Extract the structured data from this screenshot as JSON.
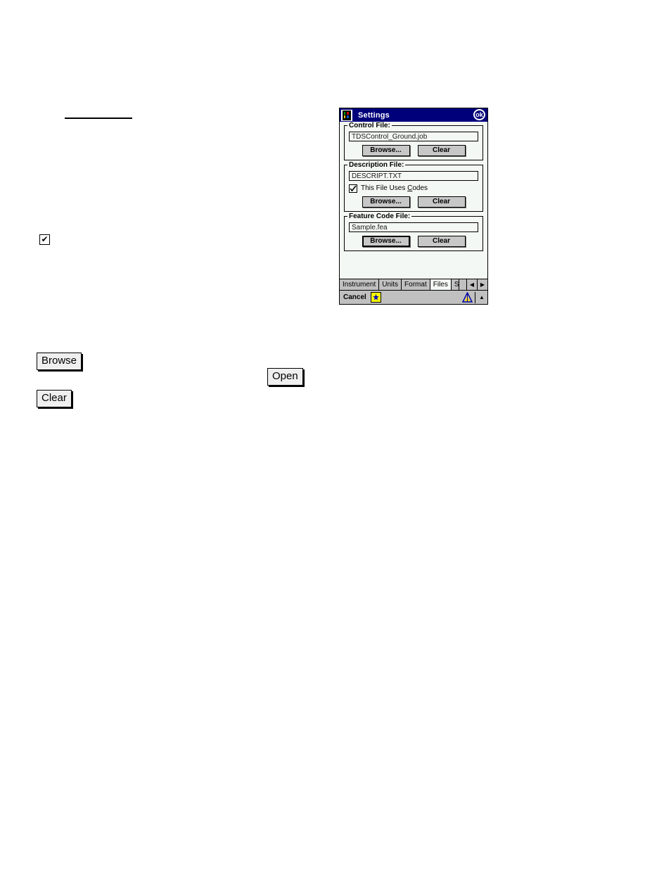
{
  "page": {
    "background": "#ffffff",
    "rule_mark": "horizontal-rule",
    "inline_graphics": {
      "browse_label": "Browse",
      "clear_label": "Clear",
      "open_label": "Open",
      "checkbox_glyph": "✔"
    }
  },
  "dialog": {
    "titlebar": {
      "app_icon": "settings-app-icon",
      "title": "Settings",
      "ok_label": "ok",
      "background": "#00007b",
      "text_color": "#ffffff"
    },
    "groups": [
      {
        "id": "control-file",
        "legend": "Control File:",
        "value": "TDSControl_Ground.job",
        "browse_label": "Browse...",
        "clear_label": "Clear",
        "browse_focused": false,
        "checkbox": null
      },
      {
        "id": "description-file",
        "legend": "Description File:",
        "value": "DESCRIPT.TXT",
        "browse_label": "Browse...",
        "clear_label": "Clear",
        "browse_focused": false,
        "checkbox": {
          "checked": true,
          "label_before": "This File Uses ",
          "label_accel": "C",
          "label_after": "odes",
          "full_label": "This File Uses Codes"
        }
      },
      {
        "id": "feature-code-file",
        "legend": "Feature Code File:",
        "value": "Sample.fea",
        "browse_label": "Browse...",
        "clear_label": "Clear",
        "browse_focused": true,
        "checkbox": null
      }
    ],
    "tabs": {
      "items": [
        {
          "label": "Instrument",
          "active": false
        },
        {
          "label": "Units",
          "active": false
        },
        {
          "label": "Format",
          "active": false
        },
        {
          "label": "Files",
          "active": true
        },
        {
          "label": "S",
          "active": false,
          "clipped": true
        }
      ],
      "scroll_left": "◀",
      "scroll_right": "▶"
    },
    "statusbar": {
      "cancel_label": "Cancel",
      "input_panel_icon": "input-panel-icon",
      "survey_icon": "survey-tripod-icon",
      "up_arrow": "▲"
    },
    "colors": {
      "title_blue": "#00007b",
      "body": "#f4f8f4",
      "chrome_gray": "#c0c0c0",
      "button_face": "#c7c7c7",
      "accent_yellow": "#ffff00"
    }
  }
}
